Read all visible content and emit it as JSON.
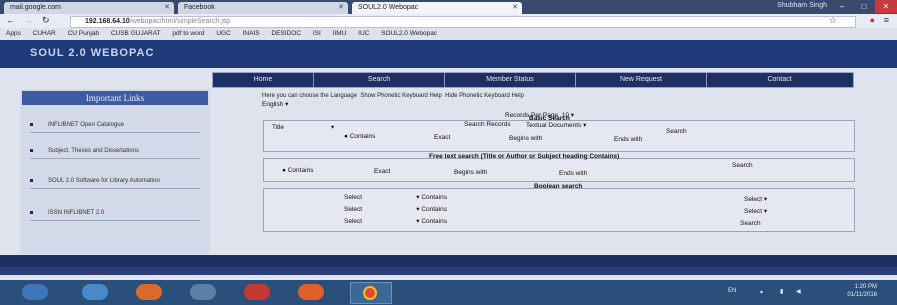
{
  "browser": {
    "tabs": [
      {
        "label": "mail.google.com"
      },
      {
        "label": "Facebook"
      },
      {
        "label": "SOUL2.0 Webopac"
      }
    ],
    "user": "Shubham Singh",
    "url_host": "192.168.64.10",
    "url_path": "/webopac/html/simpleSearch.jsp",
    "bookmarks": [
      "Apps",
      "CUHAR",
      "CU Punjab",
      "CUSB GUJARAT",
      "pdf to word",
      "UGC",
      "INAIS",
      "DESIDOC",
      "ISI",
      "IIMU",
      "IUC",
      "SOUL2.0 Webopac"
    ]
  },
  "page": {
    "logo": "SOUL 2.0 WEBOPAC",
    "nav": [
      "Home",
      "Search",
      "Member Status",
      "New Request",
      "Contact"
    ],
    "sidebar": {
      "title": "Important Links",
      "items": [
        "INFLIBNET Open Catalogue",
        "Subject, Theses and Dissertations",
        "SOUL 2.0 Software for Library Automation",
        "ISSN INFLIBNET 2.0"
      ]
    },
    "language": {
      "prompt": "Here you can choose the Language",
      "show_keyboard": "Show Phonetic Keyboard Help",
      "hide_keyboard": "Hide Phonetic Keyboard Help",
      "value": "English"
    },
    "records_per_page": {
      "label": "Records Per Page",
      "value": "10"
    },
    "basic": {
      "title": "Basic Search",
      "search_records": "Search Records",
      "doc_type": "Textual Documents",
      "field": "Title",
      "match": "Contains",
      "opt_exact": "Exact",
      "opt_begins": "Begins with",
      "opt_ends": "Ends with",
      "search_btn": "Search"
    },
    "freetext": {
      "title": "Free text search (Title or Author or Subject heading Contains)",
      "match": "Contains",
      "opt_exact": "Exact",
      "opt_begins": "Begins with",
      "opt_ends": "Ends with",
      "search_btn": "Search"
    },
    "boolean": {
      "title": "Boolean search",
      "rows": [
        {
          "field": "Select",
          "match": "Contains",
          "op": "Select"
        },
        {
          "field": "Select",
          "match": "Contains",
          "op": "Select"
        },
        {
          "field": "Select",
          "match": "Contains",
          "op": ""
        }
      ],
      "search_btn": "Search"
    }
  },
  "taskbar": {
    "lang": "EN",
    "time": "1:20 PM",
    "date": "01/11/2016"
  }
}
